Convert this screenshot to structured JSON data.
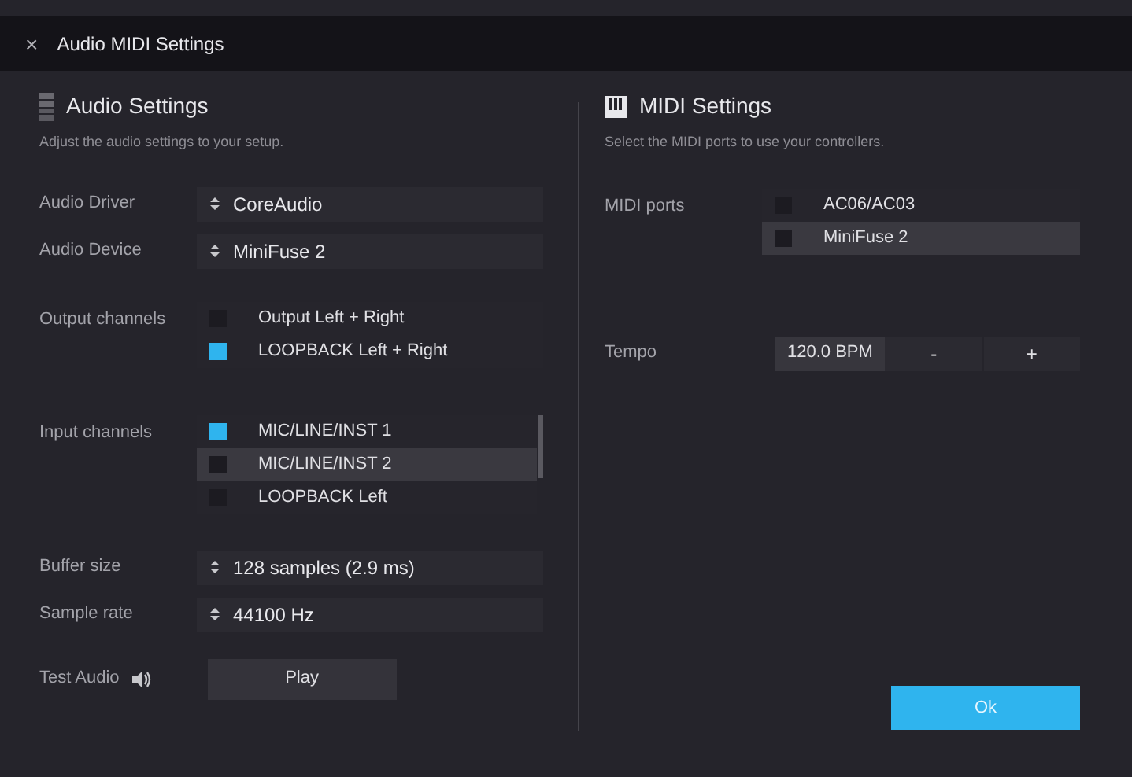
{
  "window": {
    "close": "×",
    "title": "Audio MIDI Settings"
  },
  "audio": {
    "heading": "Audio Settings",
    "description": "Adjust the audio settings to your setup.",
    "driver": {
      "label": "Audio Driver",
      "value": "CoreAudio"
    },
    "device": {
      "label": "Audio Device",
      "value": "MiniFuse 2"
    },
    "output_channels": {
      "label": "Output channels",
      "items": [
        {
          "name": "Output Left + Right",
          "checked": false,
          "selected": false
        },
        {
          "name": "LOOPBACK Left + Right",
          "checked": true,
          "selected": false
        }
      ]
    },
    "input_channels": {
      "label": "Input channels",
      "items": [
        {
          "name": "MIC/LINE/INST 1",
          "checked": true,
          "selected": false
        },
        {
          "name": "MIC/LINE/INST 2",
          "checked": false,
          "selected": true
        },
        {
          "name": "LOOPBACK Left",
          "checked": false,
          "selected": false
        }
      ]
    },
    "buffer_size": {
      "label": "Buffer size",
      "value": "128 samples (2.9 ms)"
    },
    "sample_rate": {
      "label": "Sample rate",
      "value": "44100 Hz"
    },
    "test_audio": {
      "label": "Test Audio",
      "button": "Play"
    }
  },
  "midi": {
    "heading": "MIDI Settings",
    "description": "Select the MIDI ports to use your controllers.",
    "ports": {
      "label": "MIDI ports",
      "items": [
        {
          "name": "AC06/AC03",
          "checked": false,
          "selected": false
        },
        {
          "name": "MiniFuse 2",
          "checked": false,
          "selected": true
        }
      ]
    },
    "tempo": {
      "label": "Tempo",
      "value": "120.0 BPM",
      "decrement": "-",
      "increment": "+"
    }
  },
  "ok_button": "Ok"
}
